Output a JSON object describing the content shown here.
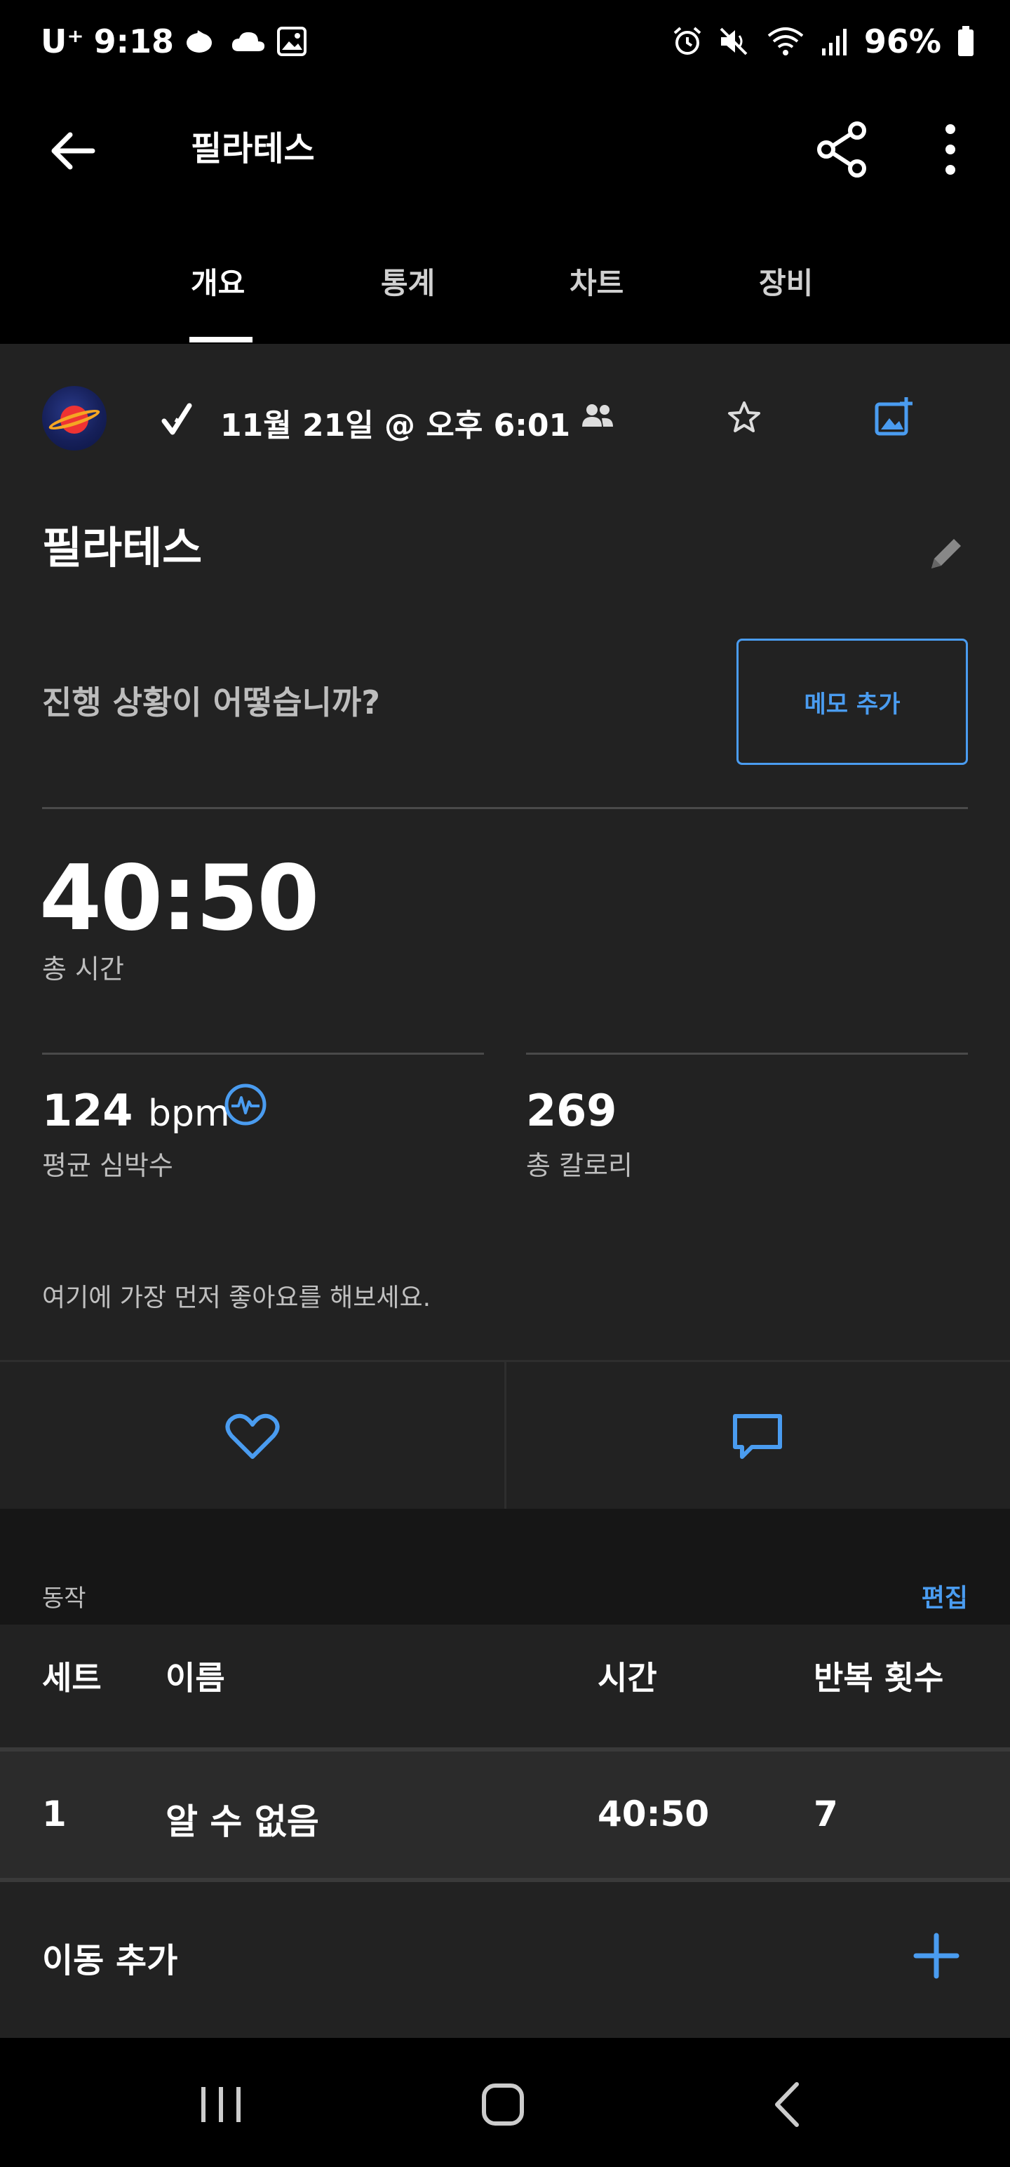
{
  "status_bar": {
    "carrier": "U⁺",
    "time": "9:18",
    "battery": "96%"
  },
  "app_bar": {
    "title": "필라테스"
  },
  "tabs": [
    {
      "label": "개요",
      "active": true
    },
    {
      "label": "통계",
      "active": false
    },
    {
      "label": "차트",
      "active": false
    },
    {
      "label": "장비",
      "active": false
    }
  ],
  "workout": {
    "date": "11월 21일 @ 오후 6:01",
    "title": "필라테스",
    "prompt": "진행 상황이 어떻습니까?",
    "memo_button": "메모 추가",
    "total_time": "40:50",
    "total_time_label": "총 시간",
    "avg_hr_value": "124",
    "avg_hr_unit": "bpm",
    "avg_hr_label": "평균 심박수",
    "calories_value": "269",
    "calories_label": "총 칼로리",
    "like_prompt": "여기에 가장 먼저 좋아요를 해보세요."
  },
  "moves": {
    "section_label": "동작",
    "edit_label": "편집",
    "columns": [
      "세트",
      "이름",
      "시간",
      "반복 횟수"
    ],
    "rows": [
      {
        "set": "1",
        "name": "알 수 없음",
        "time": "40:50",
        "reps": "7"
      }
    ],
    "add_label": "이동 추가"
  },
  "colors": {
    "accent": "#4a9cf0",
    "background": "#222222",
    "header_bg": "#000000"
  }
}
